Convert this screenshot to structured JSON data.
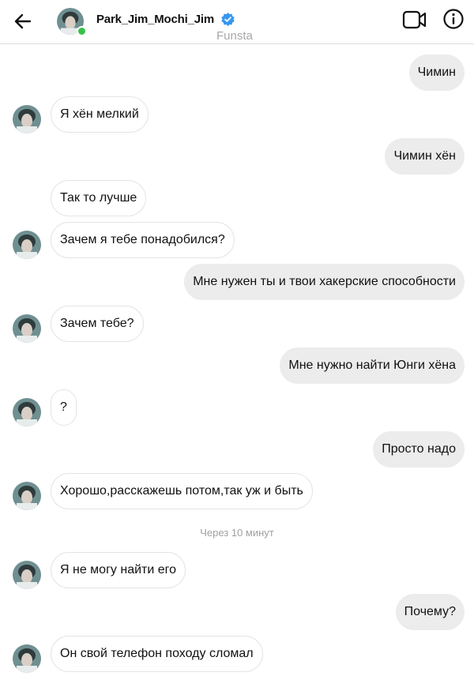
{
  "header": {
    "username": "Park_Jim_Mochi_Jim",
    "subtitle": "Funsta",
    "colors": {
      "verified": "#3897f0",
      "online": "#39c04a"
    },
    "icons": [
      "back-arrow-icon",
      "verified-badge-icon",
      "video-call-icon",
      "info-icon"
    ]
  },
  "messages": {
    "m1": "Чимин",
    "m2": "Я хён мелкий",
    "m3": "Чимин хён",
    "m4": "Так то лучше",
    "m5": "Зачем я тебе понадобился?",
    "m6": "Мне нужен ты и твои хакерские способности",
    "m7": "Зачем тебе?",
    "m8": "Мне нужно найти Юнги хёна",
    "m9": "?",
    "m10": "Просто надо",
    "m11": "Хорошо,расскажешь потом,так уж и быть",
    "timestamp": "Через 10 минут",
    "m12": "Я не могу найти его",
    "m13": "Почему?",
    "m14": "Он свой телефон походу сломал"
  }
}
